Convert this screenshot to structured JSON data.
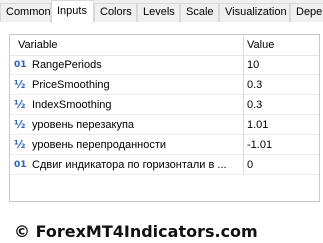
{
  "tabs": [
    "Common",
    "Inputs",
    "Colors",
    "Levels",
    "Scale",
    "Visualization",
    "Deper"
  ],
  "active_tab": "Inputs",
  "table": {
    "headers": {
      "variable": "Variable",
      "value": "Value"
    },
    "rows": [
      {
        "icon": "integer-icon",
        "icon_text": "01",
        "name": "RangePeriods",
        "value": "10"
      },
      {
        "icon": "double-icon",
        "icon_text": "½",
        "name": "PriceSmoothing",
        "value": "0.3"
      },
      {
        "icon": "double-icon",
        "icon_text": "½",
        "name": "IndexSmoothing",
        "value": "0.3"
      },
      {
        "icon": "double-icon",
        "icon_text": "½",
        "name": "уровень перезакупа",
        "value": "1.01"
      },
      {
        "icon": "double-icon",
        "icon_text": "½",
        "name": "уровень перепроданности",
        "value": "-1.01"
      },
      {
        "icon": "integer-icon",
        "icon_text": "01",
        "name": "Сдвиг индикатора по горизонтали в ...",
        "value": "0"
      }
    ]
  },
  "watermark": "© ForexMT4Indicators.com"
}
